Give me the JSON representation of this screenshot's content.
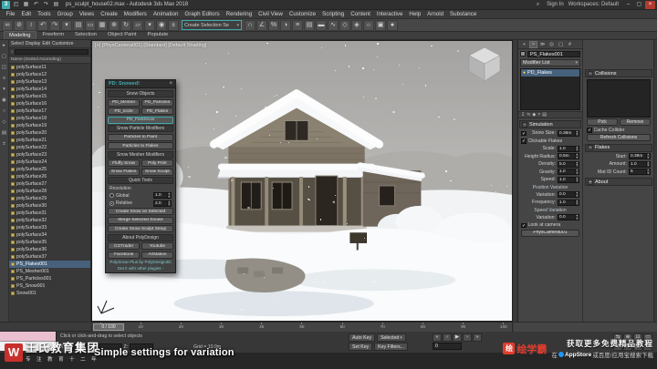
{
  "colors": {
    "accent_teal": "#3fa9ad",
    "selection_blue": "#47617c",
    "listener_pink": "#eac0d0",
    "brand_red": "#c9302c",
    "badge_red": "#e23c2e"
  },
  "titlebar": {
    "title": "ps_sculpt_house02.max - Autodesk 3ds Max 2018",
    "sign_in": "Sign In",
    "workspaces": "Workspaces: Default",
    "qat": [
      "max-logo",
      "open-file",
      "save-file",
      "undo",
      "redo",
      "project-folder"
    ],
    "window_controls": [
      "minimize",
      "maximize",
      "close"
    ]
  },
  "menubar": [
    "File",
    "Edit",
    "Tools",
    "Group",
    "Views",
    "Create",
    "Modifiers",
    "Animation",
    "Graph Editors",
    "Rendering",
    "Civil View",
    "Customize",
    "Scripting",
    "Content",
    "Interactive",
    "Help",
    "Arnold",
    "Substance"
  ],
  "toolbar": {
    "icons_left": [
      "select-and-link",
      "unlink-selection",
      "bind-to-space-warp",
      "undo",
      "redo",
      "selection-filter-dropdown",
      "select-by-name",
      "rectangular-selection-region",
      "window-crossing-toggle",
      "select-and-move",
      "select-and-rotate",
      "select-and-scale",
      "reference-coordinate-dropdown",
      "use-pivot-point-center",
      "select-and-manipulate"
    ],
    "selection_set_value": "Create Selection Se",
    "icons_right": [
      "snaps-toggle",
      "angle-snap-toggle",
      "percent-snap-toggle",
      "mirror",
      "align",
      "toggle-layer-explorer",
      "toggle-ribbon",
      "curve-editor",
      "schematic-view",
      "material-editor",
      "render-setup",
      "rendered-frame-window",
      "render-production"
    ]
  },
  "ribbon": {
    "tabs": [
      "Modeling",
      "Freeform",
      "Selection",
      "Object Paint",
      "Populate"
    ],
    "active": "Modeling"
  },
  "explorer": {
    "menus": [
      "Select",
      "Display",
      "Edit",
      "Customize"
    ],
    "sort_header": "Name (Sorted Ascending)",
    "tool_icons": [
      "pick-tool",
      "select-tool",
      "display-tool",
      "edit-tool",
      "filter-tool",
      "lock-tool",
      "hide-tool",
      "freeze-tool",
      "layer-tool",
      "settings-tool"
    ],
    "items": [
      "polySurface11",
      "polySurface12",
      "polySurface13",
      "polySurface14",
      "polySurface15",
      "polySurface16",
      "polySurface17",
      "polySurface18",
      "polySurface19",
      "polySurface20",
      "polySurface21",
      "polySurface22",
      "polySurface23",
      "polySurface24",
      "polySurface25",
      "polySurface26",
      "polySurface27",
      "polySurface28",
      "polySurface29",
      "polySurface30",
      "polySurface31",
      "polySurface32",
      "polySurface33",
      "polySurface34",
      "polySurface35",
      "polySurface36",
      "polySurface37",
      "PS_Flakes001",
      "PS_Mesher001",
      "PS_Particles001",
      "PS_Snow001",
      "Snow001"
    ],
    "selected_item": "PS_Flakes001"
  },
  "viewport": {
    "label": "[+] [PhysCamera001] [Standard] [Default Shading]"
  },
  "snow_dialog": {
    "title": "PD: Snowed!",
    "blocks": [
      {
        "type": "header",
        "text": "Snow Objects"
      },
      {
        "type": "btnrow",
        "buttons": [
          "PD_Mesher",
          "PD_Particles"
        ]
      },
      {
        "type": "btnrow",
        "buttons": [
          "PD_Icicle",
          "PD_Flakes"
        ]
      },
      {
        "type": "btnrow",
        "accent": true,
        "buttons": [
          "PD_FastSnow"
        ]
      },
      {
        "type": "header",
        "text": "Snow Particle Modifiers"
      },
      {
        "type": "btnrow",
        "buttons": [
          "Particles to Paint"
        ]
      },
      {
        "type": "btnrow",
        "buttons": [
          "Particles to Flakes"
        ]
      },
      {
        "type": "header",
        "text": "Snow Mesher Modifiers"
      },
      {
        "type": "btnrow",
        "buttons": [
          "Fluffy Snow",
          "Poly Print"
        ]
      },
      {
        "type": "btnrow",
        "buttons": [
          "Snow Flakes",
          "Snow Sculpt"
        ]
      },
      {
        "type": "header",
        "text": "Quick Tools"
      },
      {
        "type": "label",
        "text": "Resolution"
      },
      {
        "type": "radio",
        "label": "Global",
        "value": "1.0",
        "checked": false
      },
      {
        "type": "radio",
        "label": "Relative",
        "value": "2.0",
        "checked": true
      },
      {
        "type": "btnrow",
        "buttons": [
          "Create Snow on Selected"
        ]
      },
      {
        "type": "btnrow",
        "buttons": [
          "Merge Selected Snows"
        ]
      },
      {
        "type": "btnrow",
        "buttons": [
          "Create Snow Sculpt Setup"
        ]
      },
      {
        "type": "header",
        "text": "About PolyDesign"
      },
      {
        "type": "btnrow",
        "buttons": [
          "CGTrader",
          "Youtube"
        ]
      },
      {
        "type": "btnrow",
        "buttons": [
          "Facebook",
          "Artstation"
        ]
      },
      {
        "type": "footer",
        "text": "PolySnow Plus by PolyDesign3D"
      },
      {
        "type": "footer",
        "text": "Get it with other plugins -"
      }
    ]
  },
  "command_panel": {
    "tabs": [
      "create",
      "modify",
      "hierarchy",
      "motion",
      "display",
      "utilities"
    ],
    "active_tab": "modify",
    "object_name": "PS_Flakes001",
    "modifier_list_label": "Modifier List",
    "stack": [
      {
        "label": "PD_Flakes",
        "selected": true
      }
    ],
    "stack_tools": [
      "pin-stack",
      "show-end-result",
      "make-unique",
      "remove-modifier",
      "configure-modifier-sets"
    ],
    "col1_rows": [
      {
        "type": "rollout",
        "text": "Simulation"
      },
      {
        "type": "check_spin",
        "label": "Snow Size:",
        "value": "0.38m",
        "checked": true
      },
      {
        "type": "check",
        "label": "Clickable Flakes",
        "checked": true
      },
      {
        "type": "spin",
        "label": "Scale:",
        "value": "1.0"
      },
      {
        "type": "spin",
        "label": "Height Radius:",
        "value": "0.5m"
      },
      {
        "type": "spin",
        "label": "Density:",
        "value": "5.0"
      },
      {
        "type": "spin",
        "label": "Gravity:",
        "value": "1.0"
      },
      {
        "type": "spin",
        "label": "Speed:",
        "value": "1.0"
      },
      {
        "type": "sub",
        "text": "Position Variation"
      },
      {
        "type": "spin",
        "label": "Variation:",
        "value": "0.0"
      },
      {
        "type": "spin",
        "label": "Frequency:",
        "value": "1.0"
      },
      {
        "type": "sub",
        "text": "Speed Variation"
      },
      {
        "type": "spin",
        "label": "Variation:",
        "value": "0.0"
      },
      {
        "type": "check",
        "label": "Look at camera",
        "checked": true
      },
      {
        "type": "button",
        "text": "PhysCamera001"
      }
    ],
    "col2_rows": [
      {
        "type": "rollout",
        "text": "Collisions"
      },
      {
        "type": "listbox"
      },
      {
        "type": "btnrow",
        "buttons": [
          "Pick",
          "Remove"
        ]
      },
      {
        "type": "check",
        "label": "Cache Collider",
        "checked": true
      },
      {
        "type": "button",
        "text": "Refresh Collisions"
      },
      {
        "type": "rollout",
        "text": "Flakes"
      },
      {
        "type": "spin",
        "label": "Start:",
        "value": "0.39m"
      },
      {
        "type": "spin",
        "label": "Amount:",
        "value": "1.0"
      },
      {
        "type": "spin",
        "label": "Mat ID Count:",
        "value": "5"
      },
      {
        "type": "rollout_closed",
        "text": "About"
      }
    ]
  },
  "timeline": {
    "handle": "0 / 100",
    "ticks": [
      "0",
      "10",
      "20",
      "30",
      "40",
      "50",
      "60",
      "70",
      "80",
      "90",
      "100"
    ]
  },
  "statusbar": {
    "prompt": "Click or click-and-drag to select objects",
    "coords": {
      "x_label": "X:",
      "y_label": "Y:",
      "z_label": "Z:"
    },
    "grid": "Grid = 10.0m",
    "auto_key": "Auto Key",
    "set_key": "Set Key",
    "selected": "Selected",
    "key_filters": "Key Filters...",
    "time": "0",
    "playback_icons": [
      "go-to-start",
      "previous-frame",
      "play-animation",
      "next-frame",
      "go-to-end"
    ],
    "nav_icons": [
      "pan-view",
      "zoom-view",
      "zoom-extents",
      "zoom-region",
      "field-of-view",
      "orbit-viewport",
      "maximize-viewport-toggle",
      "walk-through"
    ]
  },
  "overlays": {
    "subtitle": "Simple settings for variation",
    "brand_initial": "W",
    "brand_name": "王氏教育集团",
    "brand_slogan": "专 注 教 育 十 二 年",
    "badge_initial": "绘",
    "badge_text": "绘学霸",
    "promo_line1": "获取更多免费精品教程",
    "promo_prefix": "在",
    "promo_appstore": "AppStore",
    "promo_suffix": "或百度/应用宝搜索下载"
  }
}
